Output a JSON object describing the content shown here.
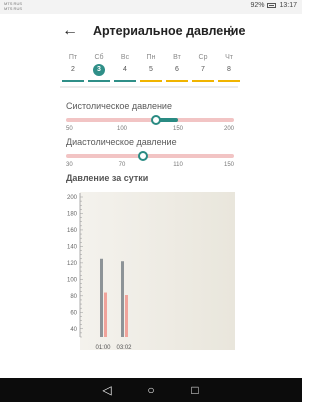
{
  "status_bar": {
    "carrier_line1": "MTS RUS",
    "carrier_line2": "MTS RUS",
    "battery": "92%",
    "time": "13:17"
  },
  "app_bar": {
    "title": "Артериальное давление",
    "back_icon": "arrow-left",
    "menu_icon": "more-vert"
  },
  "days": [
    {
      "name": "Пт",
      "num": "2",
      "selected": false,
      "bar_color": "#2f8f88"
    },
    {
      "name": "Сб",
      "num": "3",
      "selected": true,
      "bar_color": "#2f8f88"
    },
    {
      "name": "Вс",
      "num": "4",
      "selected": false,
      "bar_color": "#2f8f88"
    },
    {
      "name": "Пн",
      "num": "5",
      "selected": false,
      "bar_color": "#f0b400"
    },
    {
      "name": "Вт",
      "num": "6",
      "selected": false,
      "bar_color": "#f0b400"
    },
    {
      "name": "Ср",
      "num": "7",
      "selected": false,
      "bar_color": "#f0b400"
    },
    {
      "name": "Чт",
      "num": "8",
      "selected": false,
      "bar_color": "#f0b400"
    }
  ],
  "systolic": {
    "label": "Систолическое давление",
    "min": 50,
    "max": 200,
    "range_low": 130,
    "range_high": 150,
    "thumb_value": 130,
    "ticks": [
      "50",
      "100",
      "150",
      "200"
    ]
  },
  "diastolic": {
    "label": "Диастолическое давление",
    "min": 30,
    "max": 150,
    "range_low": 85,
    "range_high": 85,
    "thumb_value": 85,
    "ticks": [
      "30",
      "70",
      "110",
      "150"
    ]
  },
  "daily": {
    "label": "Давление за сутки"
  },
  "chart_data": {
    "type": "bar",
    "categories": [
      "01:00",
      "03:02"
    ],
    "series": [
      {
        "values": [
          125,
          122
        ],
        "color": "#8d9397"
      },
      {
        "values": [
          84,
          81
        ],
        "color": "#f0a39b"
      }
    ],
    "ylim": [
      30,
      200
    ],
    "yticks": [
      "40",
      "60",
      "80",
      "100",
      "120",
      "140",
      "160",
      "180",
      "200"
    ],
    "grid": false
  },
  "colors": {
    "accent": "#2a8b83",
    "track": "#f2c4c4"
  },
  "nav": {
    "back": "back-triangle",
    "home": "home-circle",
    "recents": "recents-square"
  }
}
